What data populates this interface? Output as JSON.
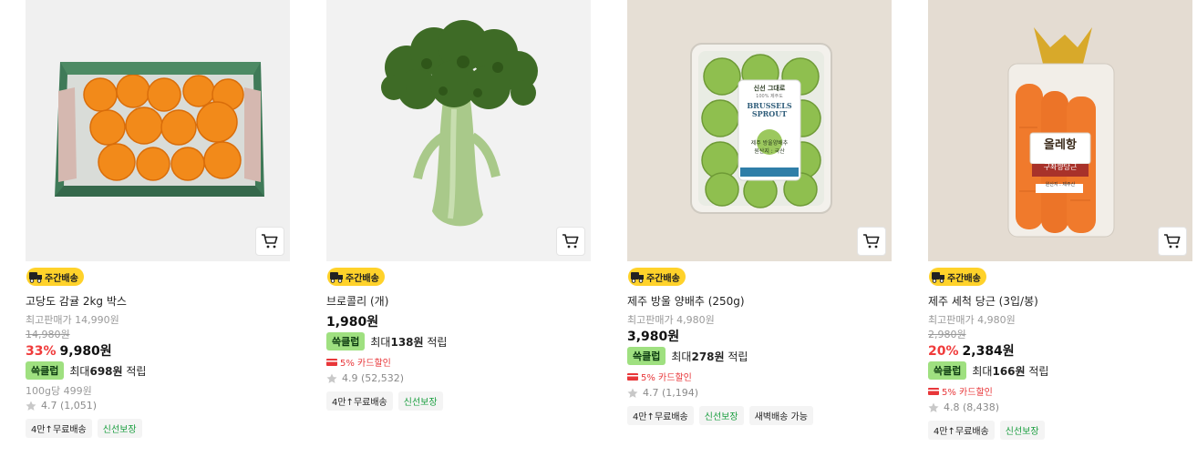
{
  "icons": {
    "cart": "cart-icon",
    "truck": "delivery-truck-icon",
    "star": "star-icon",
    "card": "credit-card-icon"
  },
  "colors": {
    "badge_bg": "#ffd22a",
    "club_tag_bg": "#9fe080",
    "discount_red": "#f03b3b",
    "fresh_green": "#1a9e3f"
  },
  "products": [
    {
      "badge": "주간배송",
      "name": "고당도 감귤 2kg 박스",
      "highest_price": "최고판매가 14,990원",
      "original_price": "14,980원",
      "discount_rate": "33%",
      "price": "9,980원",
      "club_tag": "쓱클럽",
      "club_prefix": "최대",
      "club_amount": "698원",
      "club_suffix": "적립",
      "unit_price": "100g당 499원",
      "rating": "4.7",
      "reviews": "(1,051)",
      "chips": [
        "4만↑무료배송",
        "신선보장"
      ]
    },
    {
      "badge": "주간배송",
      "name": "브로콜리 (개)",
      "price": "1,980원",
      "club_tag": "쓱클럽",
      "club_prefix": "최대",
      "club_amount": "138원",
      "club_suffix": "적립",
      "card_discount": "5% 카드할인",
      "rating": "4.9",
      "reviews": "(52,532)",
      "chips": [
        "4만↑무료배송",
        "신선보장"
      ]
    },
    {
      "badge": "주간배송",
      "name": "제주 방울 양배추 (250g)",
      "highest_price": "최고판매가 4,980원",
      "price": "3,980원",
      "club_tag": "쓱클럽",
      "club_prefix": "최대",
      "club_amount": "278원",
      "club_suffix": "적립",
      "card_discount": "5% 카드할인",
      "rating": "4.7",
      "reviews": "(1,194)",
      "chips": [
        "4만↑무료배송",
        "신선보장",
        "새벽배송 가능"
      ],
      "image_text": {
        "brand": "신선 그대로",
        "origin_top": "100% 제주도",
        "title": "BRUSSELS SPROUT",
        "sub": "제주 방울양배추",
        "origin": "원산지 : 국산"
      }
    },
    {
      "badge": "주간배송",
      "name": "제주 세척 당근 (3입/봉)",
      "highest_price": "최고판매가 4,980원",
      "original_price": "2,980원",
      "discount_rate": "20%",
      "price": "2,384원",
      "club_tag": "쓱클럽",
      "club_prefix": "최대",
      "club_amount": "166원",
      "club_suffix": "적립",
      "card_discount": "5% 카드할인",
      "rating": "4.8",
      "reviews": "(8,438)",
      "chips": [
        "4만↑무료배송",
        "신선보장"
      ],
      "image_text": {
        "logo": "올레항",
        "label": "구좌향당근",
        "origin": "원산지 : 제주산"
      }
    }
  ]
}
